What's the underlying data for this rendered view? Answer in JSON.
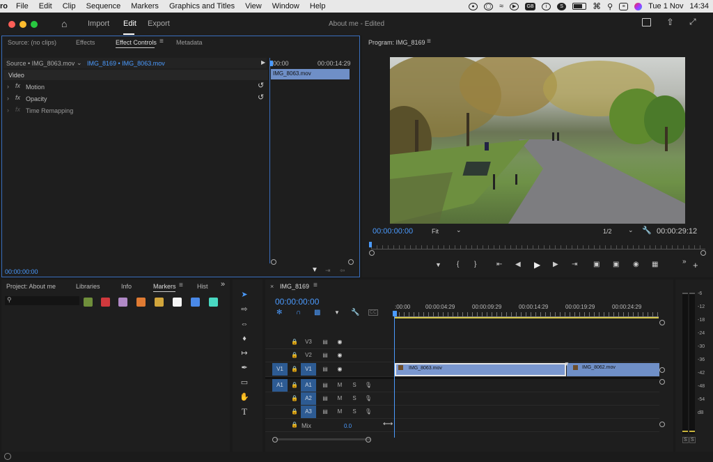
{
  "menubar": {
    "app_fragment": "ro",
    "items": [
      "File",
      "Edit",
      "Clip",
      "Sequence",
      "Markers",
      "Graphics and Titles",
      "View",
      "Window",
      "Help"
    ],
    "date": "Tue 1 Nov",
    "time": "14:34",
    "kbd_badge": "GB"
  },
  "header": {
    "tabs": {
      "import": "Import",
      "edit": "Edit",
      "export": "Export"
    },
    "doc_title": "About me",
    "doc_status": "- Edited"
  },
  "effect_controls": {
    "tabs": [
      "Source: (no clips)",
      "Effects",
      "Effect Controls",
      "Metadata"
    ],
    "source_label": "Source • IMG_8063.mov",
    "sequence_label": "IMG_8169 • IMG_8063.mov",
    "ruler_start": "00:00",
    "ruler_end": "00:00:14:29",
    "clip_name": "IMG_8063.mov",
    "section": "Video",
    "effects": [
      "Motion",
      "Opacity",
      "Time Remapping"
    ],
    "timecode": "00:00:00:00"
  },
  "program": {
    "title": "Program: IMG_8169",
    "timecode": "00:00:00:00",
    "fit": "Fit",
    "resolution": "1/2",
    "duration": "00:00:29:12"
  },
  "project": {
    "tabs": [
      "Project: About me",
      "Libraries",
      "Info",
      "Markers",
      "Histo"
    ],
    "marker_colors": [
      "#6f8f3b",
      "#d0393d",
      "#b089c6",
      "#e07b33",
      "#d2a63c",
      "#f5f5f5",
      "#4a89e8",
      "#49d8c2"
    ]
  },
  "timeline": {
    "sequence_name": "IMG_8169",
    "timecode": "00:00:00:00",
    "ruler_labels": [
      ":00:00",
      "00:00:04:29",
      "00:00:09:29",
      "00:00:14:29",
      "00:00:19:29",
      "00:00:24:29"
    ],
    "video_tracks": [
      {
        "src": "",
        "name": "V3"
      },
      {
        "src": "",
        "name": "V2"
      },
      {
        "src": "V1",
        "name": "V1"
      }
    ],
    "audio_tracks": [
      {
        "src": "A1",
        "name": "A1"
      },
      {
        "src": "",
        "name": "A2"
      },
      {
        "src": "",
        "name": "A3"
      }
    ],
    "mix_label": "Mix",
    "mix_value": "0.0",
    "clips": [
      "IMG_8063.mov",
      "IMG_8062.mov"
    ],
    "mute_label": "M",
    "solo_label": "S"
  },
  "meter": {
    "labels": [
      "-6",
      "-12",
      "-18",
      "-24",
      "-30",
      "-36",
      "-42",
      "-48",
      "-54",
      "dB"
    ],
    "solo": [
      "S",
      "S"
    ]
  },
  "colors": {
    "accent": "#4b9bff",
    "selected_track": "#2d5b93",
    "clip": "#6f8fc7"
  }
}
